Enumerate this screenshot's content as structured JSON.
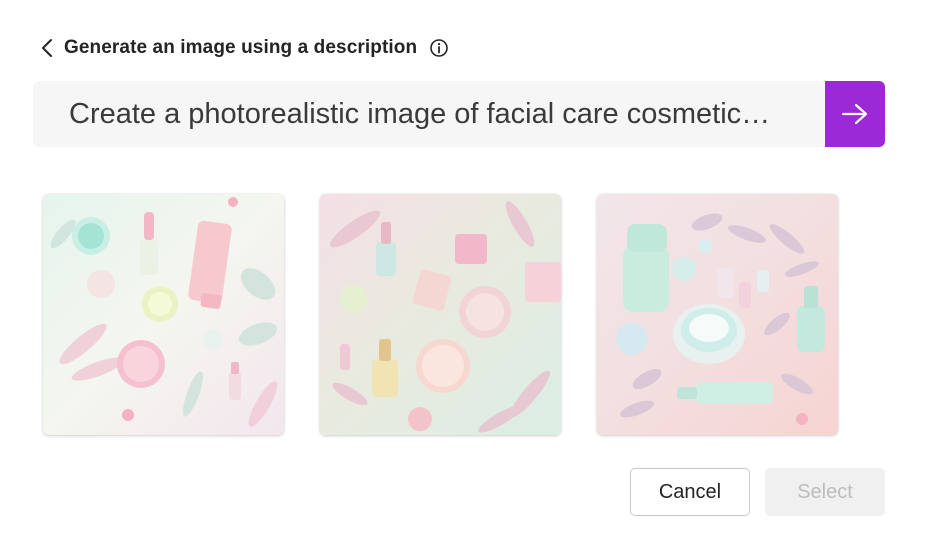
{
  "header": {
    "title": "Generate an image using a description"
  },
  "prompt": {
    "value": "Create a photorealistic image of facial care cosmetic…"
  },
  "gallery": {
    "images": [
      {
        "subject": "pastel cosmetics flat lay with tubes, jars and leaves on white"
      },
      {
        "subject": "pastel cosmetics flat lay with serum bottles and compacts on mint-pink"
      },
      {
        "subject": "pastel cosmetics with open cream jar and bottles on pink"
      }
    ]
  },
  "actions": {
    "cancel_label": "Cancel",
    "select_label": "Select"
  },
  "colors": {
    "accent": "#9b2ad6",
    "input_bg": "#f6f6f6",
    "disabled_bg": "#f0f0f0",
    "disabled_text": "#bdbdbd"
  }
}
